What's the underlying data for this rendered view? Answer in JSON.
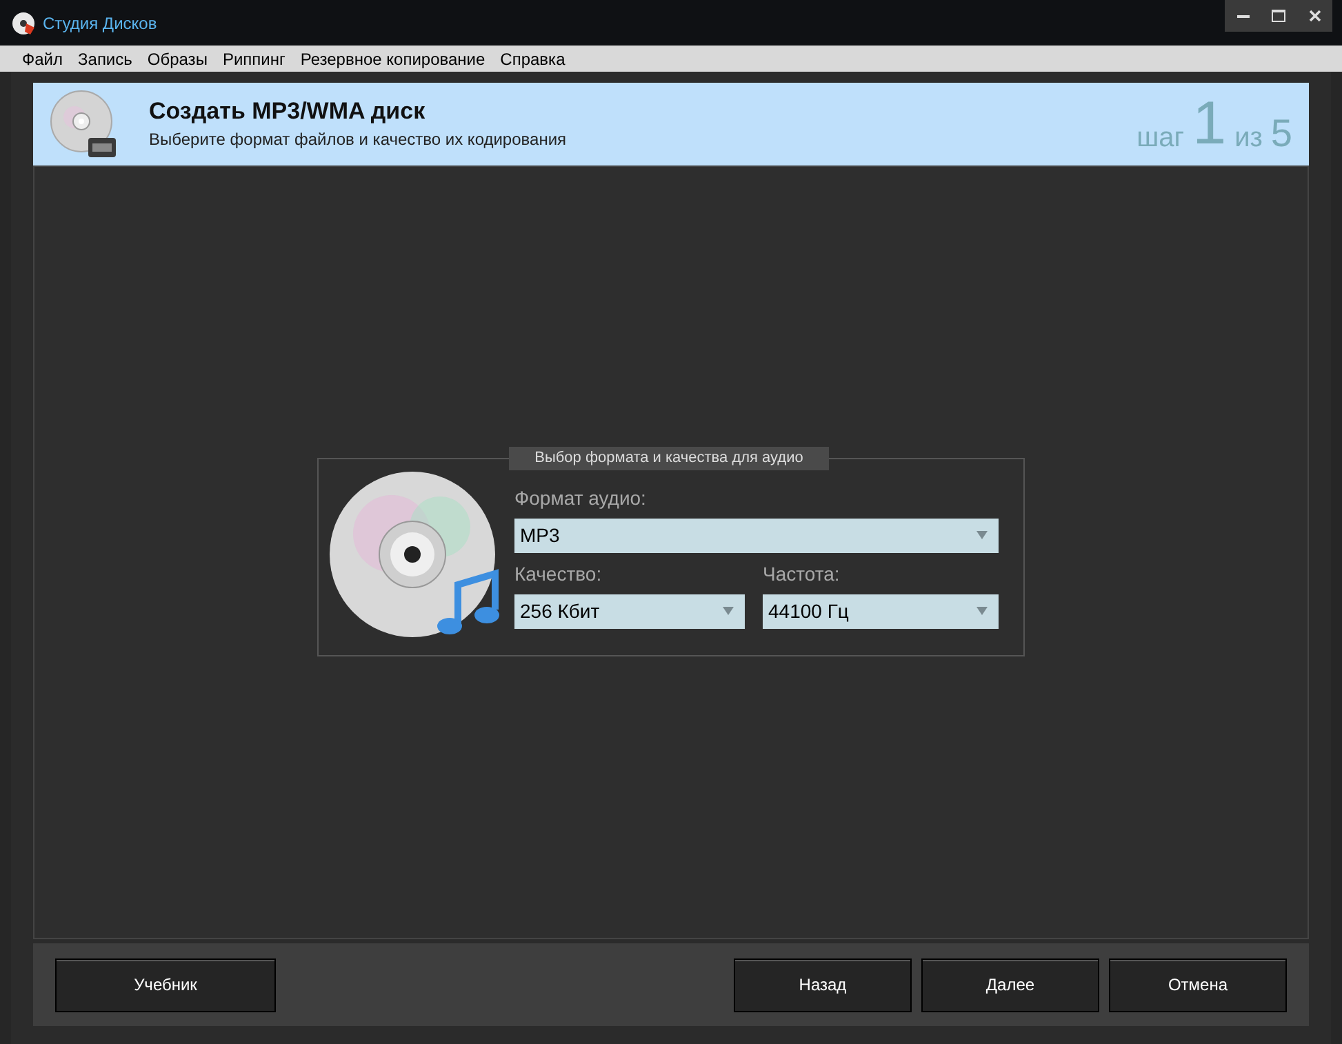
{
  "window": {
    "title": "Студия Дисков"
  },
  "menu": [
    "Файл",
    "Запись",
    "Образы",
    "Риппинг",
    "Резервное копирование",
    "Справка"
  ],
  "header": {
    "title": "Создать MP3/WMA диск",
    "subtitle": "Выберите формат файлов и качество их кодирования",
    "step_label": "шаг",
    "step": "1",
    "of_label": "из",
    "total": "5"
  },
  "group": {
    "title": "Выбор формата и качества для аудио",
    "fields": [
      {
        "label": "Формат аудио:",
        "value": "MP3"
      },
      {
        "label": "Качество:",
        "value": "256 Кбит"
      },
      {
        "label": "Частота:",
        "value": "44100 Гц"
      }
    ]
  },
  "buttons": {
    "left": [
      "Учебник"
    ],
    "right": [
      "Назад",
      "Далее",
      "Отмена"
    ]
  }
}
